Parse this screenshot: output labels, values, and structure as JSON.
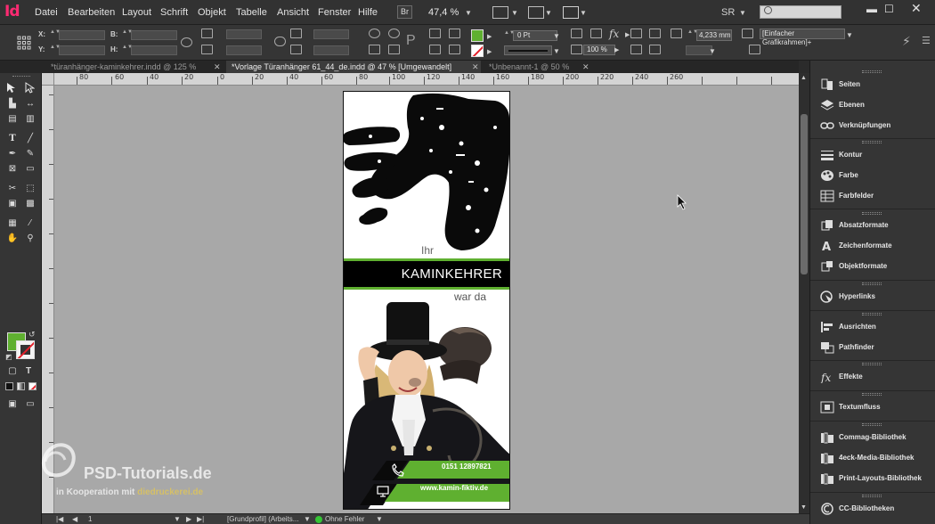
{
  "app": {
    "logo": "Id"
  },
  "menu": [
    "Datei",
    "Bearbeiten",
    "Layout",
    "Schrift",
    "Objekt",
    "Tabelle",
    "Ansicht",
    "Fenster",
    "Hilfe"
  ],
  "menubar": {
    "br_label": "Br",
    "zoom": "47,4 %",
    "workspace": "SR",
    "search_placeholder": ""
  },
  "controls": {
    "x_label": "X:",
    "y_label": "Y:",
    "w_label": "B:",
    "h_label": "H:",
    "stroke_weight": "0 Pt",
    "opacity": "100 %",
    "ref_size": "4,233 mm",
    "frame_style": "[Einfacher Grafikrahmen]+"
  },
  "tabs": [
    {
      "label": "*türanhänger-kaminkehrer.indd @ 125 %",
      "active": false
    },
    {
      "label": "*Vorlage Türanhänger 61_44_de.indd @ 47 % [Umgewandelt]",
      "active": true
    },
    {
      "label": "*Unbenannt-1 @ 50 %",
      "active": false
    }
  ],
  "ruler_h": [
    "80",
    "60",
    "40",
    "20",
    "0",
    "20",
    "40",
    "60",
    "80",
    "100",
    "120",
    "140",
    "160",
    "180",
    "200",
    "220",
    "240",
    "260"
  ],
  "document": {
    "line1": "Ihr",
    "headline": "KAMINKEHRER",
    "line2": "war da",
    "phone": "0151 12897821",
    "website": "www.kamin-fiktiv.de"
  },
  "watermark": {
    "brand": "PSD-Tutorials.de",
    "sub_prefix": "in Kooperation mit",
    "sub_brand": "diedruckerei.de"
  },
  "status": {
    "page": "1",
    "profile": "[Grundprofil] (Arbeits...",
    "errors": "Ohne Fehler"
  },
  "panels": [
    {
      "label": "Seiten",
      "icon": "pages-icon"
    },
    {
      "label": "Ebenen",
      "icon": "layers-icon"
    },
    {
      "label": "Verknüpfungen",
      "icon": "links-icon"
    },
    {
      "label": "Kontur",
      "icon": "stroke-icon"
    },
    {
      "label": "Farbe",
      "icon": "color-icon"
    },
    {
      "label": "Farbfelder",
      "icon": "swatches-icon"
    },
    {
      "label": "Absatzformate",
      "icon": "paragraph-styles-icon"
    },
    {
      "label": "Zeichenformate",
      "icon": "character-styles-icon"
    },
    {
      "label": "Objektformate",
      "icon": "object-styles-icon"
    },
    {
      "label": "Hyperlinks",
      "icon": "hyperlinks-icon"
    },
    {
      "label": "Ausrichten",
      "icon": "align-icon"
    },
    {
      "label": "Pathfinder",
      "icon": "pathfinder-icon"
    },
    {
      "label": "Effekte",
      "icon": "effects-icon"
    },
    {
      "label": "Textumfluss",
      "icon": "text-wrap-icon"
    },
    {
      "label": "Commag-Bibliothek",
      "icon": "library-icon"
    },
    {
      "label": "4eck-Media-Bibliothek",
      "icon": "library-icon"
    },
    {
      "label": "Print-Layouts-Bibliothek",
      "icon": "library-icon"
    },
    {
      "label": "CC-Bibliotheken",
      "icon": "cc-libraries-icon"
    }
  ],
  "colors": {
    "accent_green": "#5fb030",
    "app_logo": "#ff2a72",
    "stroke_red": "#e5202a"
  }
}
